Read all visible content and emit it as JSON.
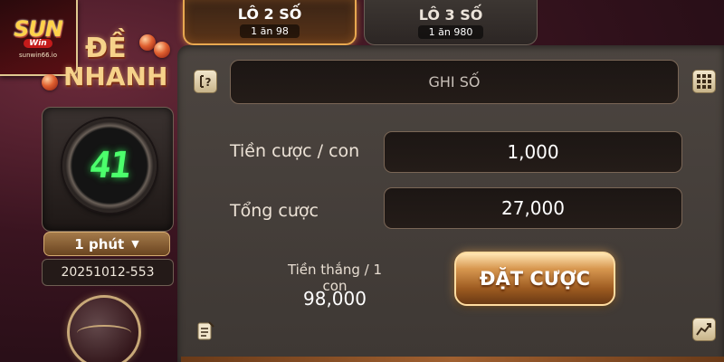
{
  "logo": {
    "brand": "SUN",
    "sub": "Win",
    "url": "sunwin66.io"
  },
  "game": {
    "title_line1": "ĐỀ",
    "title_line2": "NHANH"
  },
  "timer": {
    "countdown": "41",
    "period": "1 phút",
    "period_icon": "caret-down-icon",
    "draw_id": "20251012-553"
  },
  "tabs": [
    {
      "label": "LÔ 2 SỐ",
      "odds": "1 ăn 98",
      "active": true
    },
    {
      "label": "LÔ 3 SỐ",
      "odds": "1 ăn 980",
      "active": false
    }
  ],
  "form": {
    "number_input_placeholder": "GHI SỐ",
    "stake_per_number_label": "Tiền cược / con",
    "stake_per_number_value": "1,000",
    "total_stake_label": "Tổng cược",
    "total_stake_value": "27,000",
    "win_per_number_label": "Tiền thắng / 1 con",
    "win_per_number_value": "98,000",
    "bet_button_label": "ĐẶT CƯỢC"
  },
  "icons": {
    "help": "help-icon",
    "keypad": "keypad-icon",
    "history": "history-icon",
    "stats": "stats-chart-icon"
  },
  "colors": {
    "accent_gold": "#e8a850",
    "timer_digit": "#4cff6c",
    "panel_bg": "#4c4540"
  }
}
